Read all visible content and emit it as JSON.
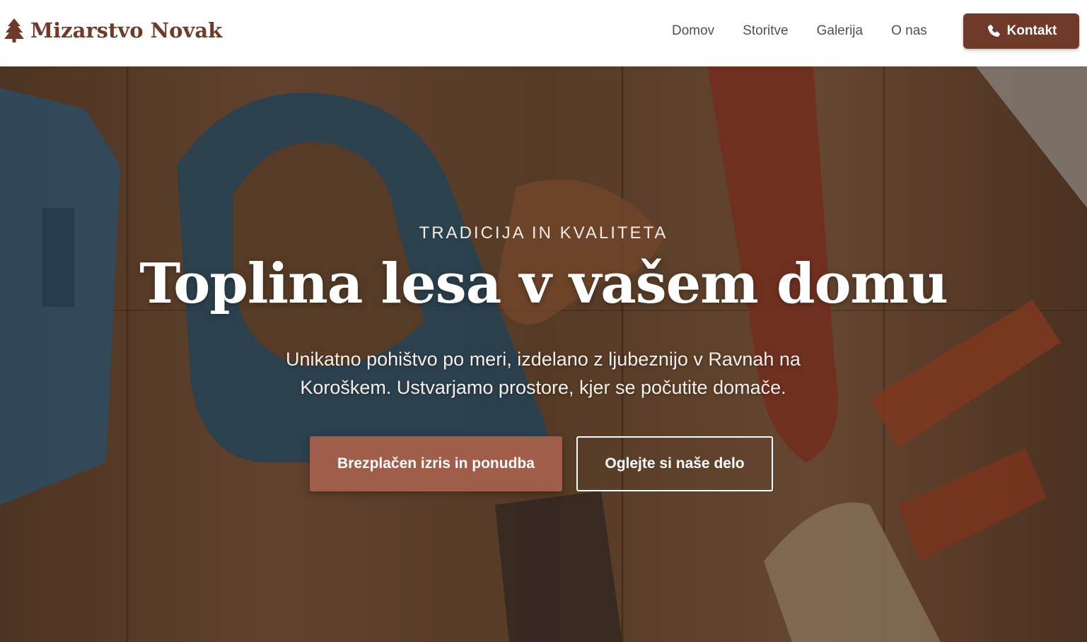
{
  "brand": {
    "name": "Mizarstvo Novak",
    "icon": "tree-icon",
    "color": "#6e3a2a"
  },
  "nav": {
    "links": [
      {
        "label": "Domov"
      },
      {
        "label": "Storitve"
      },
      {
        "label": "Galerija"
      },
      {
        "label": "O nas"
      }
    ],
    "contact_button": {
      "label": "Kontakt",
      "icon": "phone-icon"
    }
  },
  "hero": {
    "eyebrow": "TRADICIJA IN KVALITETA",
    "title": "Toplina lesa v vašem domu",
    "subtitle": "Unikatno pohištvo po meri, izdelano z ljubeznijo v Ravnah na Koroškem. Ustvarjamo prostore, kjer se počutite domače.",
    "primary_button": "Brezplačen izris in ponudba",
    "secondary_button": "Oglejte si naše delo"
  },
  "colors": {
    "accent": "#6e3a2a",
    "primary_button": "#a05e4a"
  }
}
